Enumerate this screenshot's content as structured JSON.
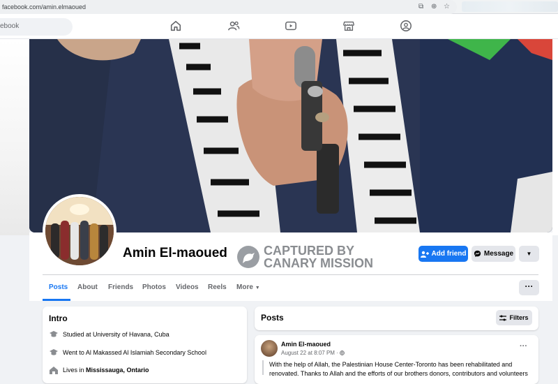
{
  "browser": {
    "url": "facebook.com/amin.elmaoued"
  },
  "nav": {
    "search_placeholder": "ebook"
  },
  "profile": {
    "name": "Amin El-maoued"
  },
  "watermark": {
    "line1": "CAPTURED BY",
    "line2": "CANARY MISSION"
  },
  "actions": {
    "add_friend": "Add friend",
    "message": "Message"
  },
  "tabs": [
    "Posts",
    "About",
    "Friends",
    "Photos",
    "Videos",
    "Reels",
    "More"
  ],
  "intro": {
    "title": "Intro",
    "items": [
      {
        "text": "Studied at University of Havana, Cuba"
      },
      {
        "text": "Went to Al Makassed Al Islamiah Secondary School"
      },
      {
        "prefix": "Lives in ",
        "bold": "Mississauga, Ontario"
      }
    ]
  },
  "posts": {
    "title": "Posts",
    "filters_label": "Filters",
    "items": [
      {
        "author": "Amin El-maoued",
        "date": "August 22 at 8:07 PM",
        "line1": "With the help of Allah, the Palestinian House Center-Toronto has been rehabilitated and",
        "line2": "renovated. Thanks to Allah and the efforts of our brothers donors, contributors and volunteers"
      }
    ]
  },
  "colors": {
    "accent": "#1877f2",
    "background": "#f0f2f5"
  }
}
